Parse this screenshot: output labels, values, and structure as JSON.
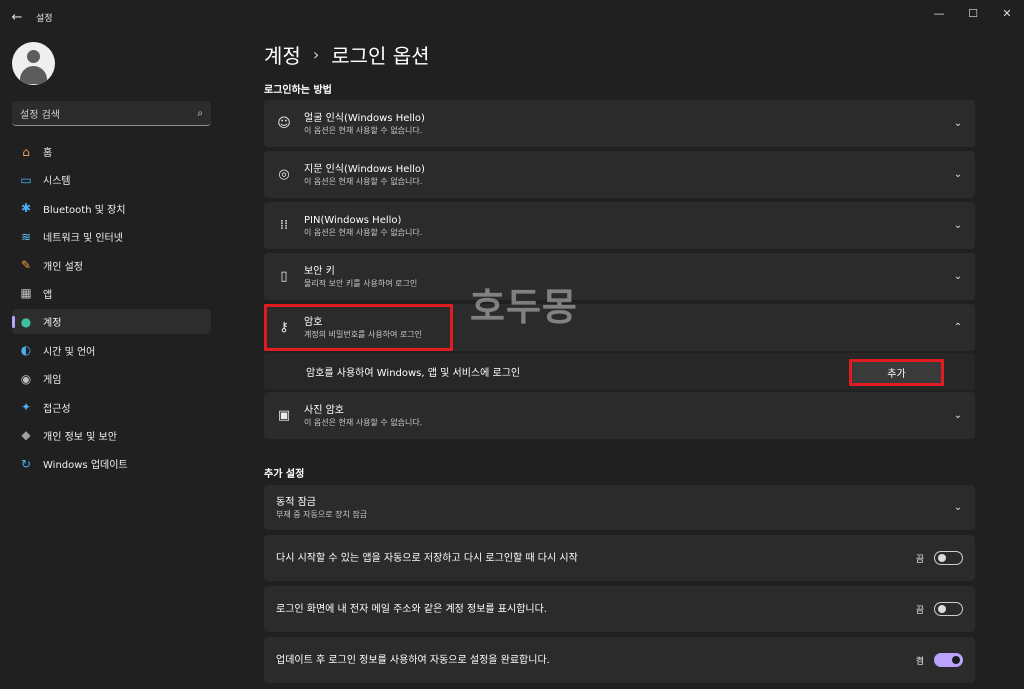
{
  "window": {
    "title": "설정",
    "minimize": "—",
    "maximize": "☐",
    "close": "✕",
    "back": "←"
  },
  "search": {
    "placeholder": "설정 검색"
  },
  "nav": [
    {
      "label": "홈",
      "icon": "home-icon",
      "glyph": "⌂",
      "color": "#f0a060"
    },
    {
      "label": "시스템",
      "icon": "system-icon",
      "glyph": "▭",
      "color": "#4ab0f0"
    },
    {
      "label": "Bluetooth 및 장치",
      "icon": "bluetooth-icon",
      "glyph": "✱",
      "color": "#4ab0f0"
    },
    {
      "label": "네트워크 및 인터넷",
      "icon": "wifi-icon",
      "glyph": "≋",
      "color": "#5ac8f0"
    },
    {
      "label": "개인 설정",
      "icon": "brush-icon",
      "glyph": "✎",
      "color": "#f0a040"
    },
    {
      "label": "앱",
      "icon": "apps-icon",
      "glyph": "▦",
      "color": "#c0c0c0"
    },
    {
      "label": "계정",
      "icon": "account-icon",
      "glyph": "●",
      "color": "#40c0a0",
      "active": true
    },
    {
      "label": "시간 및 언어",
      "icon": "globe-clock-icon",
      "glyph": "◐",
      "color": "#4ab0f0"
    },
    {
      "label": "게임",
      "icon": "gamepad-icon",
      "glyph": "◉",
      "color": "#c0c0c0"
    },
    {
      "label": "접근성",
      "icon": "accessibility-icon",
      "glyph": "✦",
      "color": "#4ab0f0"
    },
    {
      "label": "개인 정보 및 보안",
      "icon": "shield-icon",
      "glyph": "◆",
      "color": "#a0a0a0"
    },
    {
      "label": "Windows 업데이트",
      "icon": "update-icon",
      "glyph": "↻",
      "color": "#4ab0f0"
    }
  ],
  "breadcrumb": {
    "parent": "계정",
    "separator": "›",
    "current": "로그인 옵션"
  },
  "signin": {
    "heading": "로그인하는 방법",
    "items": [
      {
        "title": "얼굴 인식(Windows Hello)",
        "sub": "이 옵션은 현재 사용할 수 없습니다.",
        "icon": "face-icon",
        "glyph": "☺"
      },
      {
        "title": "지문 인식(Windows Hello)",
        "sub": "이 옵션은 현재 사용할 수 없습니다.",
        "icon": "fingerprint-icon",
        "glyph": "◎"
      },
      {
        "title": "PIN(Windows Hello)",
        "sub": "이 옵션은 현재 사용할 수 없습니다.",
        "icon": "pin-keypad-icon",
        "glyph": "⁞⁞"
      },
      {
        "title": "보안 키",
        "sub": "물리적 보안 키를 사용하여 로그인",
        "icon": "usb-key-icon",
        "glyph": "▯"
      },
      {
        "title": "암호",
        "sub": "계정의 비밀번호를 사용하여 로그인",
        "icon": "key-icon",
        "glyph": "⚷"
      },
      {
        "title": "사진 암호",
        "sub": "이 옵션은 현재 사용할 수 없습니다.",
        "icon": "picture-icon",
        "glyph": "▣"
      }
    ],
    "password_detail": "암호를 사용하여 Windows, 앱 및 서비스에 로그인",
    "add_button": "추가"
  },
  "additional": {
    "heading": "추가 설정",
    "dynamic_lock": {
      "title": "동적 잠금",
      "sub": "부재 중 자동으로 장치 잠금"
    },
    "toggles": [
      {
        "label": "다시 시작할 수 있는 앱을 자동으로 저장하고 다시 로그인할 때 다시 시작",
        "state": "끔",
        "on": false
      },
      {
        "label": "로그인 화면에 내 전자 메일 주소와 같은 계정 정보를 표시합니다.",
        "state": "끔",
        "on": false
      },
      {
        "label": "업데이트 후 로그인 정보를 사용하여 자동으로 설정을 완료합니다.",
        "state": "켬",
        "on": true
      }
    ]
  },
  "watermark": "호두몽",
  "colors": {
    "accent": "#b9a3ff",
    "highlight": "#e11b22",
    "card": "#2b2b2b",
    "background": "#202020"
  }
}
